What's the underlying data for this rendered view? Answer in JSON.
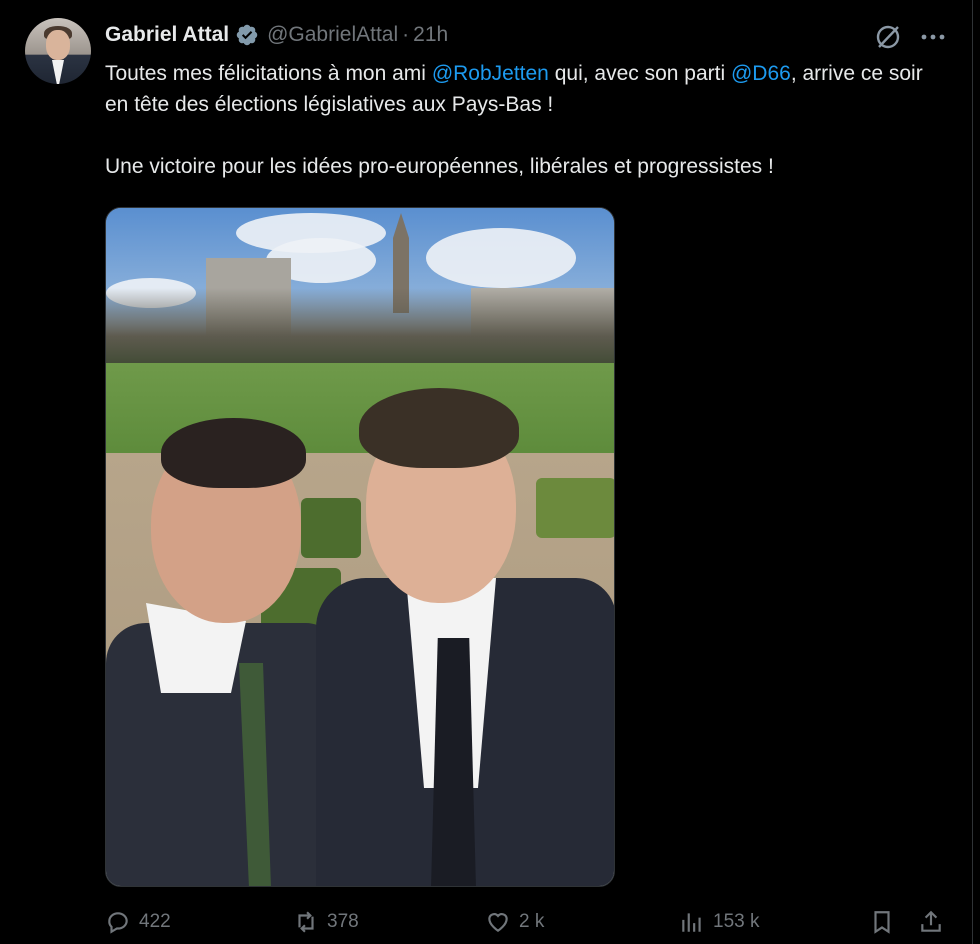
{
  "author": {
    "name": "Gabriel Attal",
    "handle": "@GabrielAttal",
    "separator": "·",
    "time": "21h"
  },
  "tweet": {
    "p1_a": "Toutes mes félicitations à mon ami ",
    "mention1": "@RobJetten",
    "p1_b": " qui, avec son parti ",
    "mention2": "@D66",
    "p1_c": ", arrive ce soir en tête des élections législatives aux Pays-Bas !",
    "p2": "Une victoire pour les idées pro-européennes, libérales et progressistes !"
  },
  "stats": {
    "replies": "422",
    "reposts": "378",
    "likes": "2 k",
    "views": "153 k"
  },
  "colors": {
    "background": "#000000",
    "text": "#e7e9ea",
    "muted": "#71767b",
    "link": "#1d9bf0",
    "verified": "#829aab"
  },
  "icons": [
    "verified-badge-icon",
    "grok-icon",
    "more-icon",
    "reply-icon",
    "repost-icon",
    "like-icon",
    "views-icon",
    "bookmark-icon",
    "share-icon"
  ]
}
